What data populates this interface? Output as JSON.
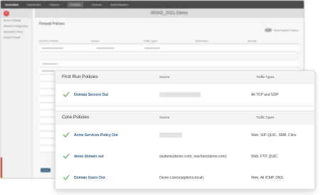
{
  "background": {
    "app_logo": "SonicWall",
    "nav": [
      "Dashboard",
      "Objects",
      "Policies",
      "Devices",
      "Administration"
    ],
    "active_nav": "Policies",
    "titlebar": "MSAD_2021-Demo",
    "sidebar_items": [
      "Device Settings",
      "Network Configuration",
      "Application Policy",
      "Device Firewall"
    ],
    "panel_title": "Firewall Policies",
    "toggle_label": "Show System Policies",
    "grid_columns": [
      "First Run Policies",
      "Source",
      "Traffic Types",
      "Destination",
      "Security"
    ]
  },
  "card": {
    "sections": [
      {
        "title": "First Run Policies",
        "source_header": "Source",
        "traffic_header": "Traffic Types",
        "rows": [
          {
            "name": "Domain Servers Out",
            "source": "",
            "traffic": "All TCP and UDP"
          }
        ]
      },
      {
        "title": "Core Policies",
        "source_header": "Source",
        "traffic_header": "Traffic Types",
        "rows": [
          {
            "name": "Acme Services Policy Out",
            "source": "",
            "traffic": "Web, SIP, QUIC, SMB, Citrix"
          },
          {
            "name": "demo domain out",
            "source": "students(demo.com), teachers(demo.com)",
            "traffic": "Web, FTP, QUIC"
          },
          {
            "name": "Domain Users Out",
            "source": "Demo-Users(wgdemo.local)",
            "traffic": "Web, All ICMP, DNS"
          }
        ]
      }
    ]
  },
  "colors": {
    "check_green": "#5cb85c",
    "policy_link": "#2d5f8a",
    "topbar": "#4a4a4a",
    "accent_red": "#c0392b"
  }
}
